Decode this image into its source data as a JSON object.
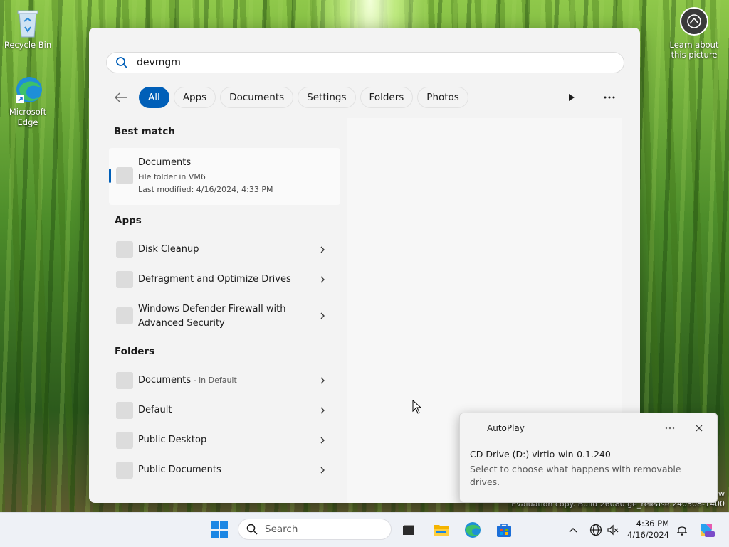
{
  "desktop": {
    "recycle_bin_label": "Recycle Bin",
    "edge_label_line1": "Microsoft",
    "edge_label_line2": "Edge",
    "learn_line1": "Learn about",
    "learn_line2": "this picture",
    "watermark_line1": "ew",
    "watermark_line2": "Evaluation copy. Build 26080.ge_release.240308-1400"
  },
  "search": {
    "query": "devmgm",
    "filters": [
      "All",
      "Apps",
      "Documents",
      "Settings",
      "Folders",
      "Photos"
    ],
    "active_filter": "All"
  },
  "results": {
    "best_match_heading": "Best match",
    "best_match": {
      "title": "Documents",
      "subtitle": "File folder in VM6",
      "modified": "Last modified: 4/16/2024, 4:33 PM"
    },
    "apps_heading": "Apps",
    "apps": [
      {
        "label": "Disk Cleanup"
      },
      {
        "label": "Defragment and Optimize Drives"
      },
      {
        "label_line1": "Windows Defender Firewall with",
        "label_line2": "Advanced Security"
      }
    ],
    "folders_heading": "Folders",
    "folders": [
      {
        "label": "Documents",
        "suffix": " - in Default"
      },
      {
        "label": "Default"
      },
      {
        "label": "Public Desktop"
      },
      {
        "label": "Public Documents"
      }
    ]
  },
  "toast": {
    "app_name": "AutoPlay",
    "title": "CD Drive (D:) virtio-win-0.1.240",
    "body": "Select to choose what happens with removable drives."
  },
  "taskbar": {
    "search_label": "Search",
    "time": "4:36 PM",
    "date": "4/16/2024"
  },
  "colors": {
    "accent": "#005fb8",
    "panel_bg": "#f3f3f3"
  }
}
